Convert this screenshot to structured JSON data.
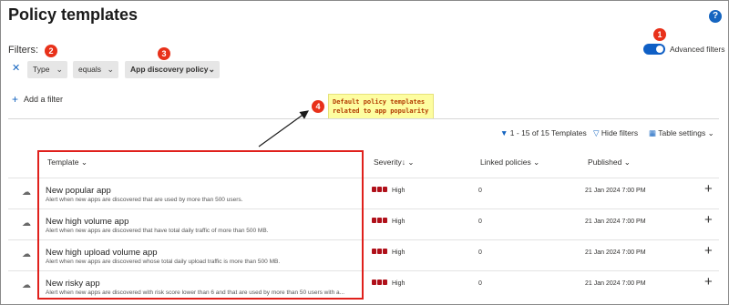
{
  "page": {
    "title": "Policy templates",
    "help_icon": "question-icon"
  },
  "filters": {
    "label": "Filters:",
    "chips": [
      {
        "label": "Type"
      },
      {
        "label": "equals"
      },
      {
        "label": "App discovery policy"
      }
    ],
    "add_filter_label": "Add a filter",
    "advanced_filters_label": "Advanced filters",
    "advanced_filters_on": true
  },
  "callouts": [
    {
      "number": "1"
    },
    {
      "number": "2"
    },
    {
      "number": "3"
    },
    {
      "number": "4",
      "text_line1": "Default policy templates",
      "text_line2": "related to app popularity"
    }
  ],
  "toolbar": {
    "count_label": "1 - 15 of 15 Templates",
    "hide_filters_label": "Hide filters",
    "table_settings_label": "Table settings"
  },
  "table": {
    "columns": [
      {
        "label": "Template"
      },
      {
        "label": "Severity"
      },
      {
        "label": "Linked policies"
      },
      {
        "label": "Published"
      }
    ],
    "rows": [
      {
        "title": "New popular app",
        "description": "Alert when new apps are discovered that are used by more than 500 users.",
        "severity": "High",
        "linked": "0",
        "published": "21 Jan 2024 7:00 PM"
      },
      {
        "title": "New high volume app",
        "description": "Alert when new apps are discovered that have total daily traffic of more than 500 MB.",
        "severity": "High",
        "linked": "0",
        "published": "21 Jan 2024 7:00 PM"
      },
      {
        "title": "New high upload volume app",
        "description": "Alert when new apps are discovered whose total daily upload traffic is more than 500 MB.",
        "severity": "High",
        "linked": "0",
        "published": "21 Jan 2024 7:00 PM"
      },
      {
        "title": "New risky app",
        "description": "Alert when new apps are discovered with risk score lower than 6 and that are used by more than 50 users with a...",
        "severity": "High",
        "linked": "0",
        "published": "21 Jan 2024 7:00 PM"
      }
    ]
  },
  "colors": {
    "accent": "#1565c0",
    "callout_red": "#e8311a",
    "severity_high": "#b0101a",
    "highlight_yellow": "#fdfda0"
  }
}
